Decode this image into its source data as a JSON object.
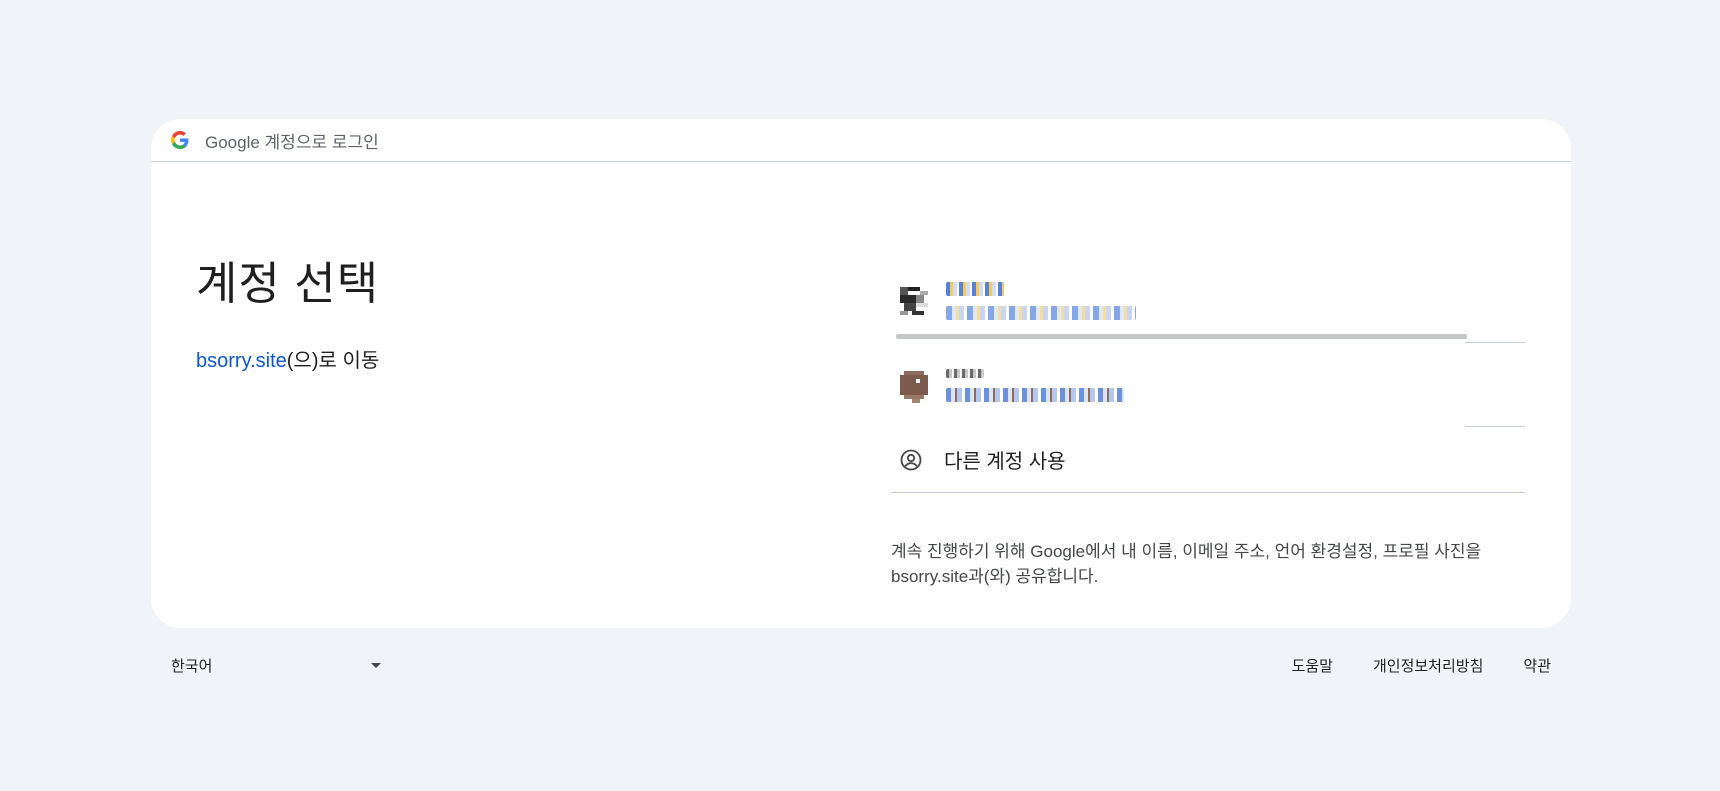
{
  "header": {
    "title": "Google 계정으로 로그인",
    "logo_icon": "google-g-icon"
  },
  "main": {
    "title": "계정 선택",
    "subtitle_link": "bsorry.site",
    "subtitle_suffix": "(으)로 이동"
  },
  "accounts": {
    "other_label": "다른 계정 사용",
    "other_icon": "account-circle-icon"
  },
  "notice": {
    "text": "계속 진행하기 위해 Google에서 내 이름, 이메일 주소, 언어 환경설정, 프로필 사진을 bsorry.site과(와) 공유합니다."
  },
  "footer": {
    "language": "한국어",
    "help": "도움말",
    "privacy": "개인정보처리방침",
    "terms": "약관"
  },
  "colors": {
    "background": "#f0f4f9",
    "card": "#ffffff",
    "link": "#0b57d0",
    "divider": "#c8cdd3"
  }
}
